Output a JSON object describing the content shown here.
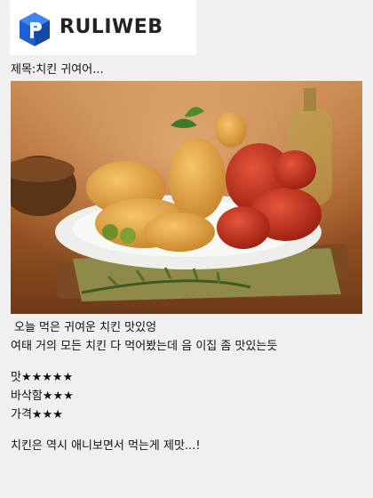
{
  "site": {
    "logo_text": "RULIWEB",
    "logo_icon": "ruliweb-cube-icon"
  },
  "post": {
    "title": "제목:치킨 귀여어...",
    "image_icon": "fried-chicken-photo",
    "lines": [
      "오늘 먹은 귀여운 치킨 맛있엉",
      "여태 거의 모든 치킨 다 먹어봤는데 음 이집 좀 맛있는듯"
    ],
    "ratings": [
      {
        "label": "맛",
        "stars": "★★★★★"
      },
      {
        "label": "바삭함",
        "stars": "★★★"
      },
      {
        "label": "가격",
        "stars": "★★★"
      }
    ],
    "closing": "치킨은 역시 애니보면서 먹는게 제맛...!"
  },
  "colors": {
    "background": "#f0f0f0",
    "logo_blue": "#1d5fd6"
  }
}
